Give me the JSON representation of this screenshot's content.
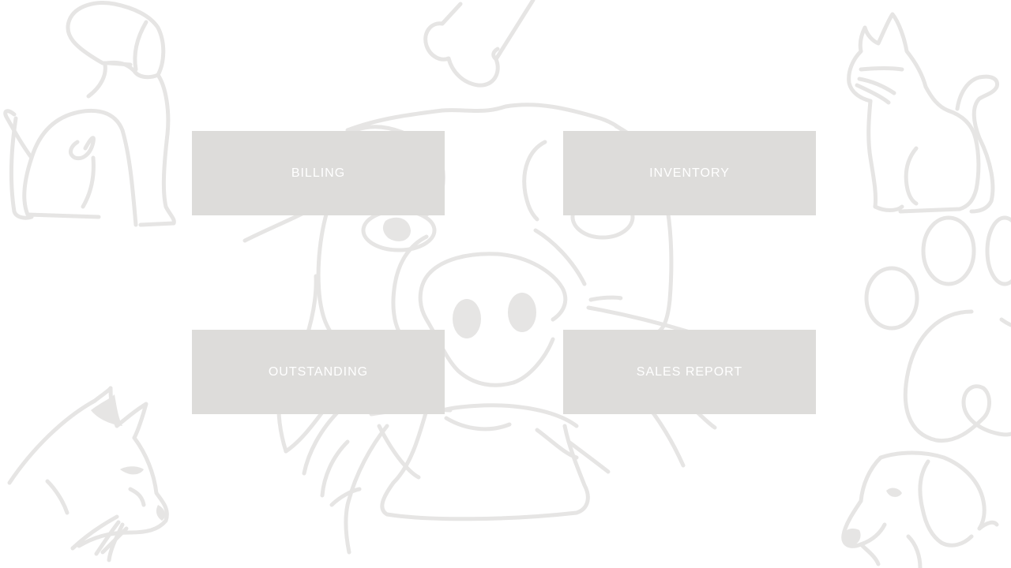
{
  "menu": {
    "billing": "BILLING",
    "inventory": "INVENTORY",
    "outstanding": "OUTSTANDING",
    "sales_report": "SALES REPORT"
  },
  "background": {
    "illustrations": [
      "dog-outline-icon",
      "bone-icon",
      "pig-face-outline-icon",
      "cat-sitting-outline-icon",
      "paw-print-icon",
      "cat-head-outline-icon",
      "dog-head-outline-icon"
    ]
  },
  "colors": {
    "button_bg": "#dddcda",
    "button_text": "#ffffff",
    "line_art": "#e6e5e4",
    "page_bg": "#ffffff"
  }
}
